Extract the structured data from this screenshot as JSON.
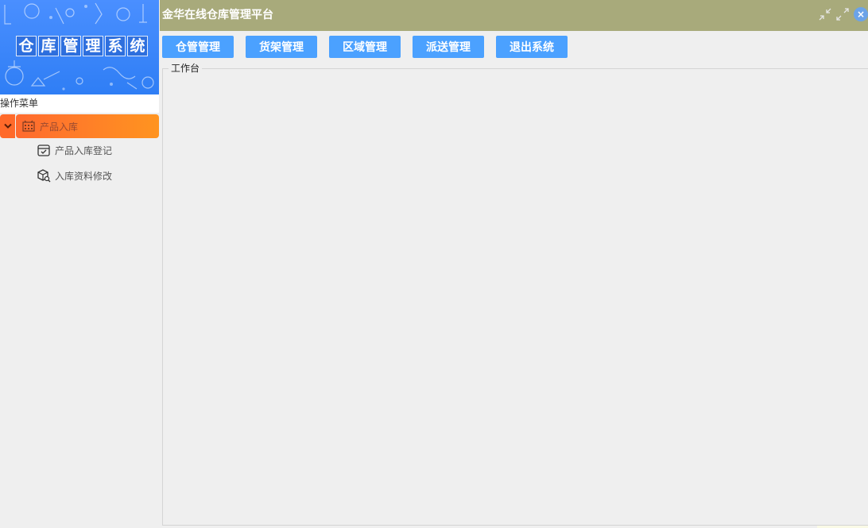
{
  "banner": {
    "title_chars": [
      "仓",
      "库",
      "管",
      "理",
      "系",
      "统"
    ],
    "icon": "lab-equipment-illustration"
  },
  "sidebar": {
    "header": "操作菜单",
    "group": {
      "label": "产品入库",
      "icon": "inventory-grid-icon",
      "toggle_icon": "chevron-down-icon",
      "items": [
        {
          "label": "产品入库登记",
          "icon": "register-box-icon"
        },
        {
          "label": "入库资料修改",
          "icon": "package-search-icon"
        }
      ]
    }
  },
  "topbar": {
    "title": "金华在线仓库管理平台",
    "close_glyph": "×"
  },
  "nav": {
    "buttons": [
      "仓管管理",
      "货架管理",
      "区域管理",
      "派送管理",
      "退出系统"
    ]
  },
  "workbench": {
    "legend": "工作台"
  },
  "colors": {
    "topbar": "#a8aa7b",
    "nav_button": "#4ba1ff",
    "menu_active_start": "#ff6a2f",
    "menu_active_end": "#ff9420",
    "banner": "#3a86f8"
  }
}
